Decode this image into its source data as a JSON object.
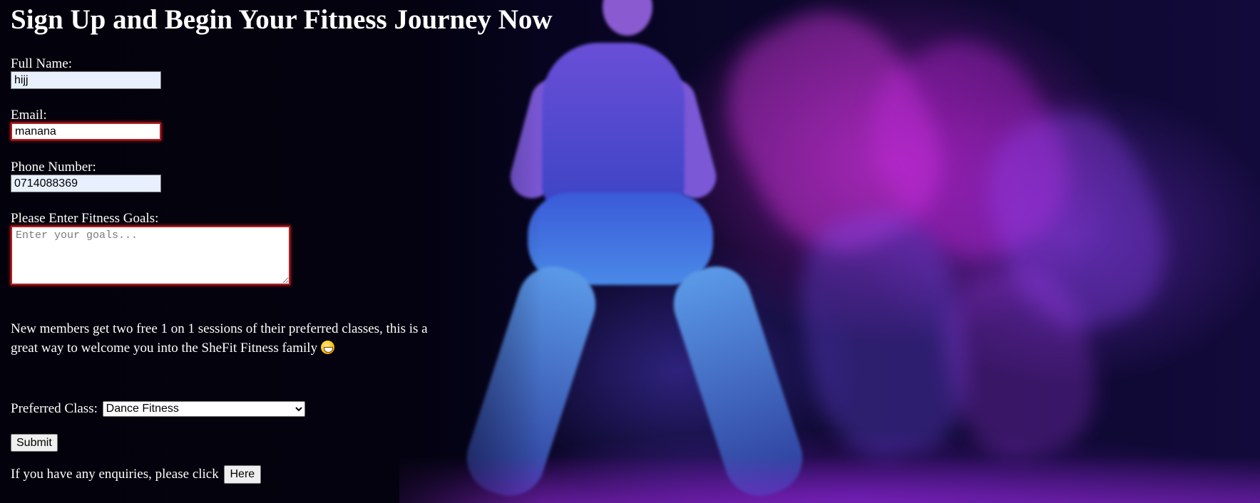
{
  "page": {
    "heading": "Sign Up and Begin Your Fitness Journey Now"
  },
  "form": {
    "full_name": {
      "label": "Full Name:",
      "value": "hijj"
    },
    "email": {
      "label": "Email:",
      "value": "manana"
    },
    "phone": {
      "label": "Phone Number:",
      "value": "0714088369"
    },
    "goals": {
      "label": "Please Enter Fitness Goals:",
      "placeholder": "Enter your goals..."
    },
    "preferred_class": {
      "label": "Preferred Class:",
      "selected": "Dance Fitness"
    },
    "submit_label": "Submit"
  },
  "promo": {
    "text": "New members get two free 1 on 1 sessions of their preferred classes, this is a great way to welcome you into the SheFit Fitness family",
    "emoji": "grinning-face-icon"
  },
  "enquiry": {
    "text": "If you have any enquiries, please click",
    "button_label": "Here"
  },
  "colors": {
    "invalid_border": "#b52020",
    "autofill_bg": "#e8f0fe",
    "text": "#ffffff"
  }
}
